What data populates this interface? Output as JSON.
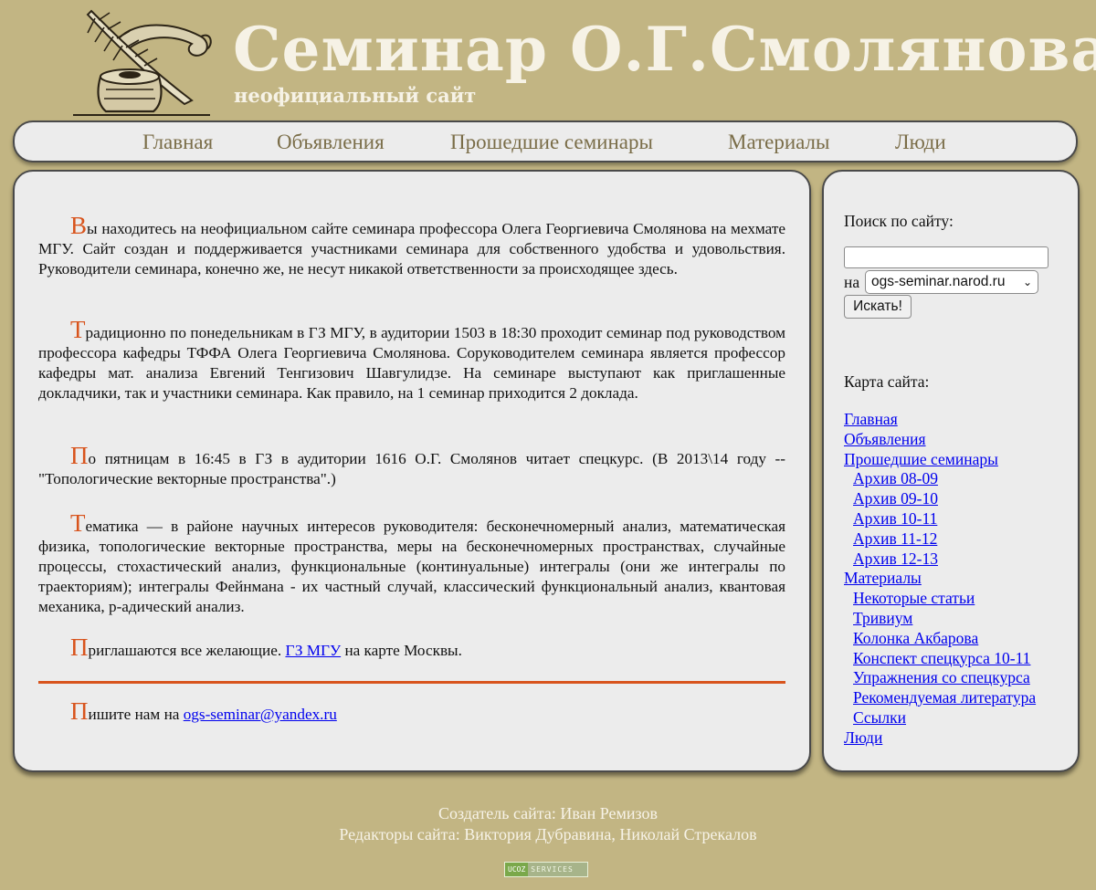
{
  "header": {
    "title": "Семинар О.Г.Смолянова",
    "subtitle": "неофициальный сайт"
  },
  "nav": {
    "items": [
      "Главная",
      "Объявления",
      "Прошедшие семинары",
      "Материалы",
      "Люди"
    ]
  },
  "main": {
    "paragraphs": [
      {
        "cap": "В",
        "text": "ы находитесь на неофициальном сайте семинара профессора Олега Георгиевича Смолянова на мехмате МГУ. Сайт создан и поддерживается участниками семинара для собственного удобства и удовольствия. Руководители семинара, конечно же, не несут никакой ответственности за происходящее здесь."
      },
      {
        "cap": "Т",
        "text": "радиционно по понедельникам в ГЗ МГУ, в аудитории 1503 в 18:30 проходит семинар под руководством профессора кафедры ТФФА Олега Георгиевича Смолянова. Соруководителем семинара является профессор кафедры мат. анализа Евгений Тенгизович Шавгулидзе. На семинаре выступают как приглашенные докладчики, так и участники семинара. Как правило, на 1 семинар приходится 2 доклада."
      },
      {
        "cap": "П",
        "text": "о пятницам в 16:45 в ГЗ в аудитории 1616 О.Г. Смолянов читает спецкурс. (В 2013\\14 году -- \"Топологические векторные пространства\".)"
      },
      {
        "cap": "Т",
        "text": "ематика — в районе научных интересов руководителя: бесконечномерный анализ, математическая физика, топологические векторные пространства, меры на бесконечномерных пространствах, случайные процессы, стохастический анализ, функциональные (континуальные) интегралы (они же интегралы по траекториям); интегралы Фейнмана - их частный случай, классический функциональный анализ, квантовая механика, p-адический анализ."
      }
    ],
    "invite": {
      "cap": "П",
      "before": "риглашаются все желающие. ",
      "link": "ГЗ МГУ",
      "after": " на карте Москвы."
    },
    "contact": {
      "cap": "П",
      "before": "ишите нам на ",
      "email": "ogs-seminar@yandex.ru"
    }
  },
  "sidebar": {
    "search_label": "Поиск по сайту:",
    "search_value": "",
    "on_label": "на",
    "site_selected": "ogs-seminar.narod.ru",
    "search_button": "Искать!",
    "map_label": "Карта сайта:",
    "map_links": [
      {
        "label": "Главная",
        "sub": false
      },
      {
        "label": "Объявления",
        "sub": false
      },
      {
        "label": "Прошедшие семинары",
        "sub": false
      },
      {
        "label": "Архив 08-09",
        "sub": true
      },
      {
        "label": "Архив 09-10",
        "sub": true
      },
      {
        "label": "Архив 10-11",
        "sub": true
      },
      {
        "label": "Архив 11-12",
        "sub": true
      },
      {
        "label": "Архив 12-13",
        "sub": true
      },
      {
        "label": "Материалы",
        "sub": false
      },
      {
        "label": "Некоторые статьи",
        "sub": true
      },
      {
        "label": "Тривиум",
        "sub": true
      },
      {
        "label": "Колонка Акбарова",
        "sub": true
      },
      {
        "label": "Конспект спецкурса 10-11",
        "sub": true
      },
      {
        "label": "Упражнения со спецкурса",
        "sub": true
      },
      {
        "label": "Рекомендуемая литература",
        "sub": true
      },
      {
        "label": "Ссылки",
        "sub": true
      },
      {
        "label": "Люди",
        "sub": false
      }
    ]
  },
  "footer": {
    "creator": "Создатель сайта: Иван Ремизов",
    "editors": "Редакторы сайта: Виктория Дубравина, Николай Стрекалов",
    "badge_left": "UCOZ",
    "badge_right": "SERVICES"
  },
  "colors": {
    "background": "#c2b583",
    "panel": "#ececec",
    "accent": "#d8541d",
    "nav_text": "#7a6d48",
    "link": "#0000ee"
  }
}
